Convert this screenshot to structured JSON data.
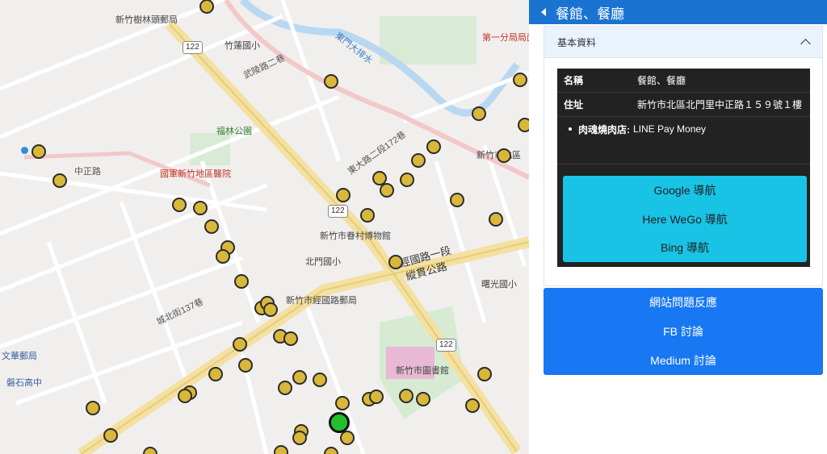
{
  "map": {
    "labels": [
      {
        "text": "新竹樹林頭郵局",
        "cls": "poi"
      },
      {
        "text": "竹蓮國小",
        "cls": "poi"
      },
      {
        "text": "武陵路二巷",
        "cls": ""
      },
      {
        "text": "東門大排水",
        "cls": "poi"
      },
      {
        "text": "第一分局局面",
        "cls": "poi"
      },
      {
        "text": "中正路",
        "cls": ""
      },
      {
        "text": "國軍新竹地區醫院",
        "cls": "hosp"
      },
      {
        "text": "福林公園",
        "cls": "poi"
      },
      {
        "text": "新竹市眷村博物館",
        "cls": "poi"
      },
      {
        "text": "北門國小",
        "cls": "poi"
      },
      {
        "text": "經國路一段",
        "cls": ""
      },
      {
        "text": "縱貫公路",
        "cls": ""
      },
      {
        "text": "新竹市經國路郵局",
        "cls": "poi"
      },
      {
        "text": "城北街137巷",
        "cls": ""
      },
      {
        "text": "新竹市圖書館",
        "cls": "poi"
      },
      {
        "text": "文華郵局",
        "cls": "poi"
      },
      {
        "text": "磐石高中",
        "cls": "poi"
      },
      {
        "text": "曙光國小",
        "cls": "poi"
      },
      {
        "text": "東大路二段172巷",
        "cls": ""
      },
      {
        "text": "新竹市北區",
        "cls": "poi"
      }
    ],
    "shields": [
      "122",
      "122",
      "122"
    ],
    "marker_count": 62
  },
  "panel": {
    "header_title": "餐館、餐廳",
    "section_title": "基本資料",
    "rows": [
      {
        "key": "名稱",
        "value": "餐館、餐廳"
      },
      {
        "key": "住址",
        "value": "新竹市北區北門里中正路１５９號１樓"
      }
    ],
    "shop": {
      "name": "肉魂燒肉店:",
      "payment": "LINE Pay Money"
    },
    "nav_buttons": [
      "Google 導航",
      "Here WeGo 導航",
      "Bing 導航"
    ],
    "links": [
      "網站問題反應",
      "FB 討論",
      "Medium 討論"
    ]
  },
  "colors": {
    "header": "#1a73d0",
    "nav": "#18c3e6",
    "links": "#1877f2",
    "marker": "#d8b73b",
    "selected": "#22c12b"
  }
}
